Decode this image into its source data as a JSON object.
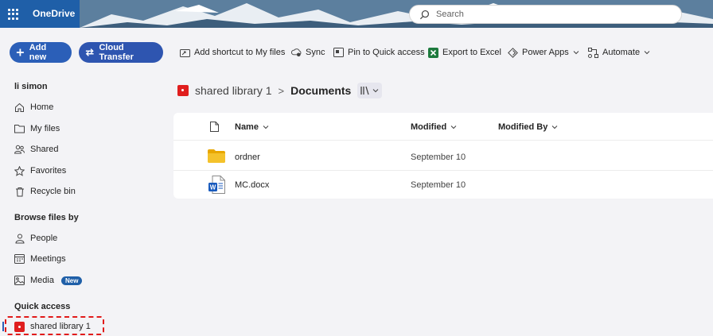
{
  "header": {
    "app_title": "OneDrive",
    "search_placeholder": "Search"
  },
  "commandbar": {
    "add_new": "Add new",
    "cloud_transfer": "Cloud Transfer",
    "add_shortcut": "Add shortcut to My files",
    "sync": "Sync",
    "pin_quick_access": "Pin to Quick access",
    "export_excel": "Export to Excel",
    "power_apps": "Power Apps",
    "automate": "Automate"
  },
  "sidebar": {
    "user": "li simon",
    "items": [
      {
        "label": "Home",
        "icon": "home-icon"
      },
      {
        "label": "My files",
        "icon": "folder-icon"
      },
      {
        "label": "Shared",
        "icon": "people-icon"
      },
      {
        "label": "Favorites",
        "icon": "star-icon"
      },
      {
        "label": "Recycle bin",
        "icon": "trash-icon"
      }
    ],
    "browse_heading": "Browse files by",
    "browse_items": [
      {
        "label": "People",
        "icon": "person-icon"
      },
      {
        "label": "Meetings",
        "icon": "calendar-icon"
      },
      {
        "label": "Media",
        "icon": "image-icon",
        "badge": "New"
      }
    ],
    "quick_access_heading": "Quick access",
    "quick_access_items": [
      {
        "label": "shared library 1",
        "icon": "library-icon",
        "highlighted": true
      }
    ]
  },
  "breadcrumb": {
    "library": "shared library 1",
    "separator": ">",
    "current": "Documents"
  },
  "file_list": {
    "columns": {
      "name": "Name",
      "modified": "Modified",
      "modified_by": "Modified By"
    },
    "rows": [
      {
        "name": "ordner",
        "type": "folder",
        "modified": "September 10",
        "modified_by": ""
      },
      {
        "name": "MC.docx",
        "type": "word",
        "modified": "September 10",
        "modified_by": ""
      }
    ]
  },
  "colors": {
    "brand_blue": "#2b5fb8",
    "highlight_red": "#e11a1a",
    "library_red": "#e01e1e",
    "folder_yellow": "#f4c22b",
    "word_blue": "#185abd",
    "excel_green": "#1d7a3d"
  }
}
